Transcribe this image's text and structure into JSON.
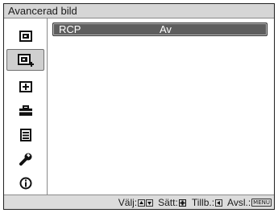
{
  "window": {
    "title": "Avancerad bild"
  },
  "sidebar": {
    "items": [
      {
        "icon": "picture-icon",
        "selected": false
      },
      {
        "icon": "advanced-picture-icon",
        "selected": true
      },
      {
        "icon": "screen-icon",
        "selected": false
      },
      {
        "icon": "setup-icon",
        "selected": false
      },
      {
        "icon": "function-icon",
        "selected": false
      },
      {
        "icon": "installation-icon",
        "selected": false
      },
      {
        "icon": "information-icon",
        "selected": false
      }
    ]
  },
  "menu": {
    "items": [
      {
        "label": "RCP",
        "value": "Av",
        "selected": true
      }
    ]
  },
  "status_bar": {
    "select_label": "Välj:",
    "set_label": "Sätt:",
    "back_label": "Tillb.:",
    "exit_label": "Avsl.:",
    "menu_key": "MENU"
  },
  "colors": {
    "highlight": "#5e5e5e",
    "bar": "#d6d6d6"
  }
}
